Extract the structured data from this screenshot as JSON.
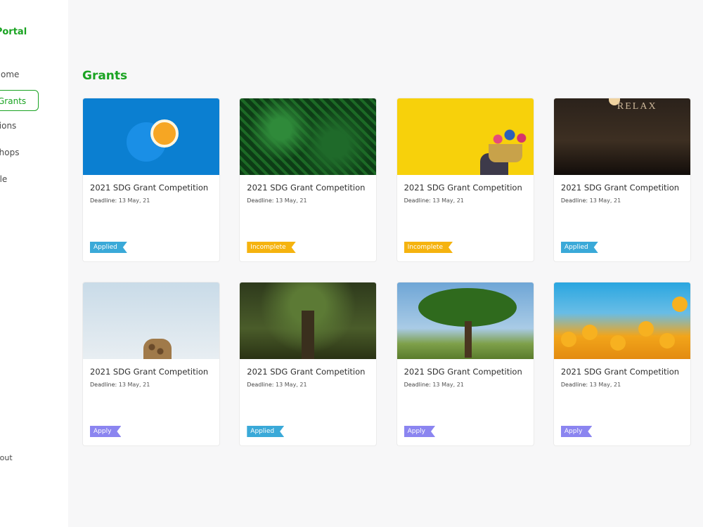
{
  "sidebar": {
    "brand": "Grant Portal",
    "items": [
      {
        "label": "Home",
        "visible": "e"
      },
      {
        "label": "Grants",
        "visible": "nts"
      },
      {
        "label": "Applications",
        "visible": "lications"
      },
      {
        "label": "Workshops",
        "visible": "kshops"
      },
      {
        "label": "Profile",
        "visible": "le"
      }
    ],
    "logout": "out"
  },
  "main": {
    "title": "Grants",
    "grants": [
      {
        "title": "2021 SDG Grant Competition",
        "deadline_label": "Deadline:",
        "deadline": "13 May, 21",
        "status": "Applied",
        "image": "orange"
      },
      {
        "title": "2021 SDG Grant Competition",
        "deadline_label": "Deadline:",
        "deadline": "13 May, 21",
        "status": "Incomplete",
        "image": "fern"
      },
      {
        "title": "2021 SDG Grant Competition",
        "deadline_label": "Deadline:",
        "deadline": "13 May, 21",
        "status": "Incomplete",
        "image": "yellow-flowers"
      },
      {
        "title": "2021 SDG Grant Competition",
        "deadline_label": "Deadline:",
        "deadline": "13 May, 21",
        "status": "Applied",
        "image": "bar"
      },
      {
        "title": "2021 SDG Grant Competition",
        "deadline_label": "Deadline:",
        "deadline": "13 May, 21",
        "status": "Apply",
        "image": "giraffe"
      },
      {
        "title": "2021 SDG Grant Competition",
        "deadline_label": "Deadline:",
        "deadline": "13 May, 21",
        "status": "Applied",
        "image": "forest"
      },
      {
        "title": "2021 SDG Grant Competition",
        "deadline_label": "Deadline:",
        "deadline": "13 May, 21",
        "status": "Apply",
        "image": "tree"
      },
      {
        "title": "2021 SDG Grant Competition",
        "deadline_label": "Deadline:",
        "deadline": "13 May, 21",
        "status": "Apply",
        "image": "poppies"
      }
    ],
    "bar_sign": "RELAX"
  },
  "colors": {
    "accent": "#1aa322",
    "applied": "#3aa9d8",
    "incomplete": "#f5b30f",
    "apply": "#8b85f0"
  }
}
